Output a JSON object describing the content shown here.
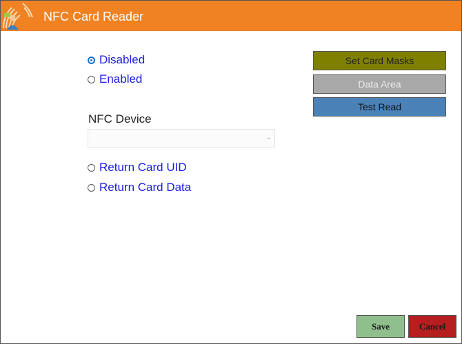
{
  "window": {
    "title": "NFC Card Reader",
    "logo_icon": "nfc-person-icon",
    "accent": "#f08224"
  },
  "mode": {
    "options": [
      {
        "label": "Disabled",
        "checked": true
      },
      {
        "label": "Enabled",
        "checked": false
      }
    ]
  },
  "device": {
    "label": "NFC Device",
    "selected_value": ""
  },
  "return_mode": {
    "options": [
      {
        "label": "Return Card UID",
        "checked": false
      },
      {
        "label": "Return Card Data",
        "checked": false
      }
    ]
  },
  "actions": {
    "set_card_masks": "Set Card Masks",
    "data_area": "Data Area",
    "test_read": "Test Read"
  },
  "footer": {
    "save": "Save",
    "cancel": "Cancel"
  }
}
